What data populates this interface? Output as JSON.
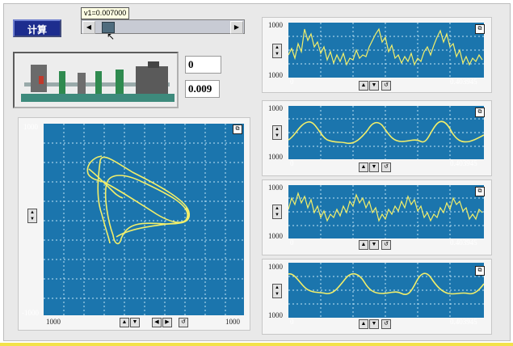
{
  "toolbar": {
    "calc_label": "计算",
    "tooltip": "v1=0.007000",
    "slider_fraction": 0.07
  },
  "readouts": {
    "top_value": "0",
    "bottom_value": "0.009"
  },
  "main_plot": {
    "ymax": "1000",
    "ymin": "-1000",
    "xmin": "1000",
    "xmax": "1000"
  },
  "small_plots": [
    {
      "ymax": "1000",
      "ymin": "1000",
      "xmin": "0",
      "xmax": "0.403945"
    },
    {
      "ymax": "1000",
      "ymin": "1000",
      "xmin": "0",
      "xmax": "0.403945"
    },
    {
      "ymax": "1000",
      "ymin": "1000",
      "xmin": "0",
      "xmax": "0.403945"
    },
    {
      "ymax": "1000",
      "ymin": "1000",
      "xmin": "0",
      "xmax": "0.403945"
    }
  ],
  "icons": {
    "scroll_left": "triangle-left",
    "scroll_right": "triangle-right",
    "zoom": "zoom-icon",
    "up_down": "up-down-arrows",
    "reset": "reset-icon"
  },
  "colors": {
    "plot_bg": "#1b75ad",
    "trace": "#f2ef6a",
    "button": "#1d2d8e"
  }
}
